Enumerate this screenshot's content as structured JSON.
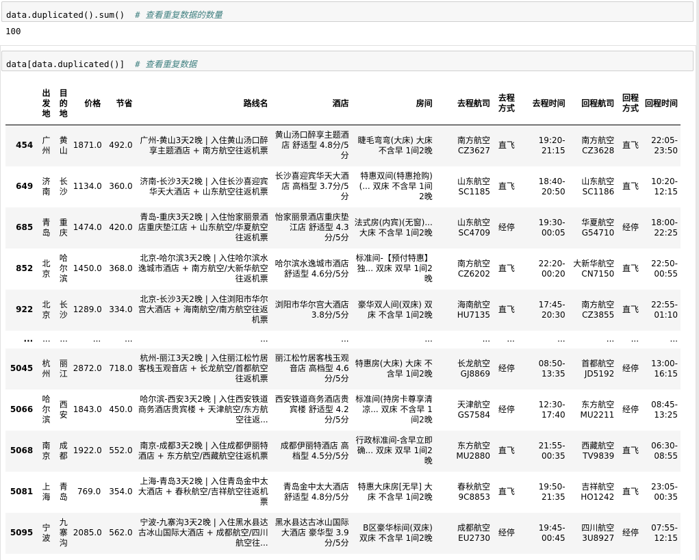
{
  "cell1": {
    "code": "data.duplicated().sum()  ",
    "comment": "# 查看重复数据的数量",
    "output": "100"
  },
  "cell2": {
    "code": "data[data.duplicated()]  ",
    "comment": "# 查看重复数据"
  },
  "table": {
    "columns": [
      "出发地",
      "目的地",
      "价格",
      "节省",
      "路线名",
      "酒店",
      "房间",
      "去程航司",
      "去程方式",
      "去程时间",
      "回程航司",
      "回程方式",
      "回程时间"
    ],
    "rows": [
      {
        "idx": "454",
        "cells": [
          "广州",
          "黄山",
          "1871.0",
          "492.0",
          "广州-黄山3天2晚 | 入住黄山汤口醉享主题酒店 + 南方航空往返机票",
          "黄山汤口醉享主题酒店 舒适型 4.8分/5分",
          "睫毛弯弯(大床) 大床 不含早 1间2晚",
          "南方航空 CZ3627",
          "直飞",
          "19:20-21:15",
          "南方航空 CZ3628",
          "直飞",
          "22:05-23:50"
        ]
      },
      {
        "idx": "649",
        "cells": [
          "济南",
          "长沙",
          "1134.0",
          "360.0",
          "济南-长沙3天2晚 | 入住长沙喜迎宾华天大酒店 + 山东航空往返机票",
          "长沙喜迎宾华天大酒店 高档型 3.7分/5分",
          "特惠双间(特惠抢购)(... 双床 不含早 1间2晚",
          "山东航空 SC1185",
          "直飞",
          "18:40-20:50",
          "山东航空 SC1186",
          "直飞",
          "10:20-12:15"
        ]
      },
      {
        "idx": "685",
        "cells": [
          "青岛",
          "重庆",
          "1474.0",
          "420.0",
          "青岛-重庆3天2晚 | 入住怡家丽景酒店重庆垫江店 + 山东航空/华夏航空往返机票",
          "怡家丽景酒店重庆垫江店 舒适型 4.3分/5分",
          "法式房(内宾)(无窗)... 大床 不含早 1间2晚",
          "山东航空 SC4709",
          "经停",
          "19:30-00:05",
          "华夏航空 G54710",
          "经停",
          "18:00-22:25"
        ]
      },
      {
        "idx": "852",
        "cells": [
          "北京",
          "哈尔滨",
          "1450.0",
          "368.0",
          "北京-哈尔滨3天2晚 | 入住哈尔滨水逸城市酒店 + 南方航空/大新华航空往返机票",
          "哈尔滨水逸城市酒店 舒适型 4.6分/5分",
          "标准间-【预付特惠】独... 双床 双早 1间2晚",
          "南方航空 CZ6202",
          "直飞",
          "22:20-00:20",
          "大新华航空 CN7150",
          "直飞",
          "22:50-00:55"
        ]
      },
      {
        "idx": "922",
        "cells": [
          "北京",
          "长沙",
          "1289.0",
          "334.0",
          "北京-长沙3天2晚 | 入住浏阳市华尔宫大酒店 + 海南航空/南方航空往返机票",
          "浏阳市华尔宫大酒店 3.8分/5分",
          "豪华双人间(双床) 双床 不含早 1间2晚",
          "海南航空 HU7135",
          "直飞",
          "17:45-20:30",
          "南方航空 CZ3855",
          "直飞",
          "22:55-01:10"
        ]
      },
      {
        "idx": "...",
        "ellipsis": true,
        "cells": [
          "...",
          "...",
          "...",
          "...",
          "...",
          "...",
          "...",
          "...",
          "...",
          "...",
          "...",
          "...",
          "..."
        ]
      },
      {
        "idx": "5045",
        "cells": [
          "杭州",
          "丽江",
          "2872.0",
          "718.0",
          "杭州-丽江3天2晚 | 入住丽江松竹居客栈玉观音店 + 长龙航空/首都航空往返机票",
          "丽江松竹居客栈玉观音店 高档型 4.6分/5分",
          "特惠房(大床) 大床 不含早 1间2晚",
          "长龙航空 GJ8869",
          "经停",
          "08:50-13:35",
          "首都航空 JD5192",
          "经停",
          "13:00-16:15"
        ]
      },
      {
        "idx": "5066",
        "cells": [
          "哈尔滨",
          "西安",
          "1843.0",
          "450.0",
          "哈尔滨-西安3天2晚 | 入住西安铁道商务酒店贵宾楼 + 天津航空/东方航空往返...",
          "西安铁道商务酒店贵宾楼 舒适型 4.2分/5分",
          "标准间(持房卡尊享清凉... 双床 不含早 1间2晚",
          "天津航空 GS7584",
          "经停",
          "12:30-17:40",
          "东方航空 MU2211",
          "经停",
          "08:45-13:25"
        ]
      },
      {
        "idx": "5068",
        "cells": [
          "南京",
          "成都",
          "1922.0",
          "552.0",
          "南京-成都3天2晚 | 入住成都伊丽特酒店 + 东方航空/西藏航空往返机票",
          "成都伊丽特酒店 高档型 4.5分/5分",
          "行政标准间-含早立即确... 双床 双早 1间2晚",
          "东方航空 MU2880",
          "直飞",
          "21:55-00:35",
          "西藏航空 TV9839",
          "直飞",
          "06:30-08:55"
        ]
      },
      {
        "idx": "5081",
        "cells": [
          "上海",
          "青岛",
          "769.0",
          "354.0",
          "上海-青岛3天2晚 | 入住青岛金中太大酒店 + 春秋航空/吉祥航空往返机票",
          "青岛金中太大酒店 舒适型 4.8分/5分",
          "特惠大床房[无早] 大床 不含早 1间2晚",
          "春秋航空 9C8853",
          "直飞",
          "19:50-21:35",
          "吉祥航空 HO1242",
          "直飞",
          "23:05-00:35"
        ]
      },
      {
        "idx": "5095",
        "cells": [
          "宁波",
          "九寨沟",
          "2085.0",
          "562.0",
          "宁波-九寨沟3天2晚 | 入住黑水县达古冰山国际大酒店 + 成都航空/四川航空往...",
          "黑水县达古冰山国际大酒店 豪华型 3.9分/5分",
          "B区豪华标间(双床) 双床 不含早 1间2晚",
          "成都航空 EU2730",
          "经停",
          "19:45-00:45",
          "四川航空 3U8927",
          "经停",
          "07:55-12:15"
        ]
      }
    ]
  }
}
